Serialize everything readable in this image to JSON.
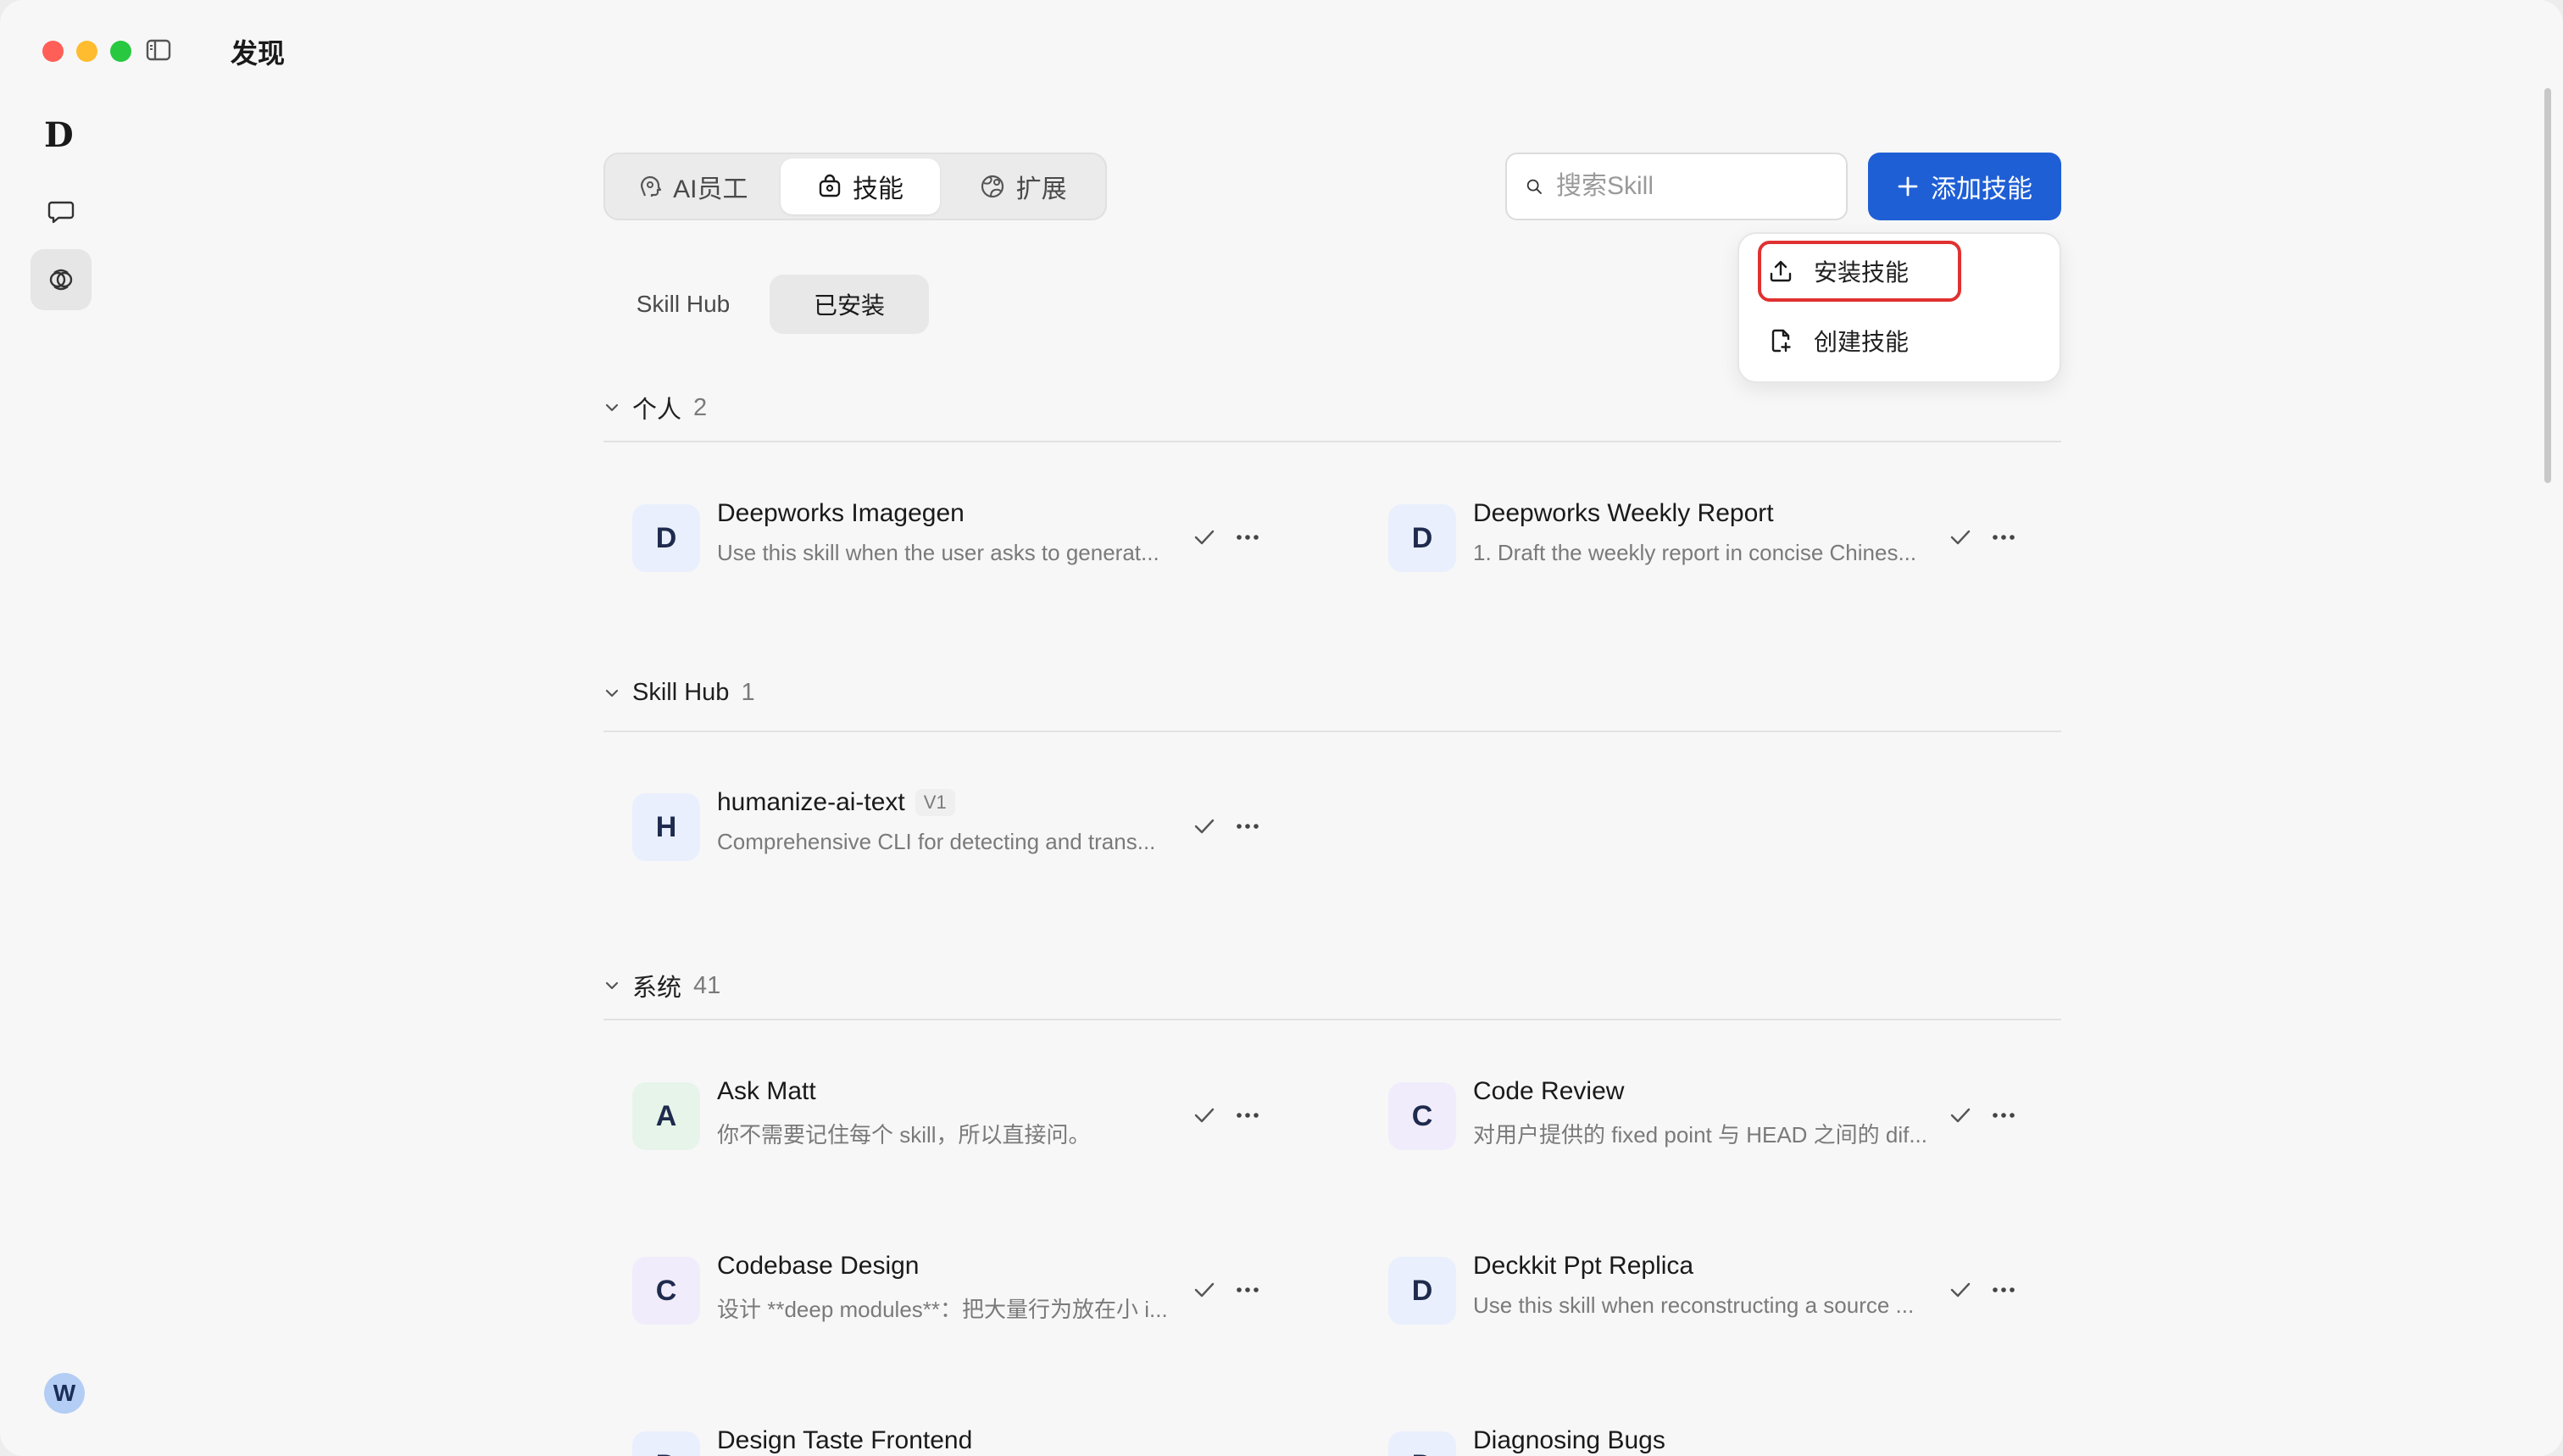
{
  "window": {
    "title": "发现"
  },
  "rail": {
    "logo": "D",
    "avatar": "W"
  },
  "main_tabs": [
    {
      "label": "AI员工",
      "icon": "ai-agent-icon"
    },
    {
      "label": "技能",
      "icon": "skill-bag-icon"
    },
    {
      "label": "扩展",
      "icon": "extension-globe-icon"
    }
  ],
  "search": {
    "placeholder": "搜索Skill",
    "value": ""
  },
  "add_button": {
    "label": "添加技能"
  },
  "dropdown": {
    "install_label": "安装技能",
    "create_label": "创建技能"
  },
  "sub_tabs": [
    {
      "label": "Skill Hub"
    },
    {
      "label": "已安装"
    }
  ],
  "sections": [
    {
      "title": "个人",
      "count": "2"
    },
    {
      "title": "Skill Hub",
      "count": "1"
    },
    {
      "title": "系统",
      "count": "41"
    }
  ],
  "skills": [
    {
      "letter": "D",
      "name": "Deepworks Imagegen",
      "desc": "Use this skill when the user asks to generat...",
      "tint": "#e9effd"
    },
    {
      "letter": "D",
      "name": "Deepworks Weekly Report",
      "desc": "1. Draft the weekly report in concise Chines...",
      "tint": "#e9effd"
    },
    {
      "letter": "H",
      "name": "humanize-ai-text",
      "version": "V1",
      "desc": "Comprehensive CLI for detecting and trans...",
      "tint": "#e9effd"
    },
    {
      "letter": "A",
      "name": "Ask Matt",
      "desc": "你不需要记住每个 skill，所以直接问。",
      "tint": "#e6f4ea"
    },
    {
      "letter": "C",
      "name": "Code Review",
      "desc": "对用户提供的 fixed point 与 HEAD 之间的 dif...",
      "tint": "#f1ecfb"
    },
    {
      "letter": "C",
      "name": "Codebase Design",
      "desc": "设计 **deep modules**：把大量行为放在小 i...",
      "tint": "#f1ecfb"
    },
    {
      "letter": "D",
      "name": "Deckkit Ppt Replica",
      "desc": "Use this skill when reconstructing a source ...",
      "tint": "#e9effd"
    },
    {
      "letter": "D",
      "name": "Design Taste Frontend",
      "desc": "",
      "tint": "#e9effd"
    },
    {
      "letter": "D",
      "name": "Diagnosing Bugs",
      "desc": "",
      "tint": "#e9effd"
    }
  ]
}
